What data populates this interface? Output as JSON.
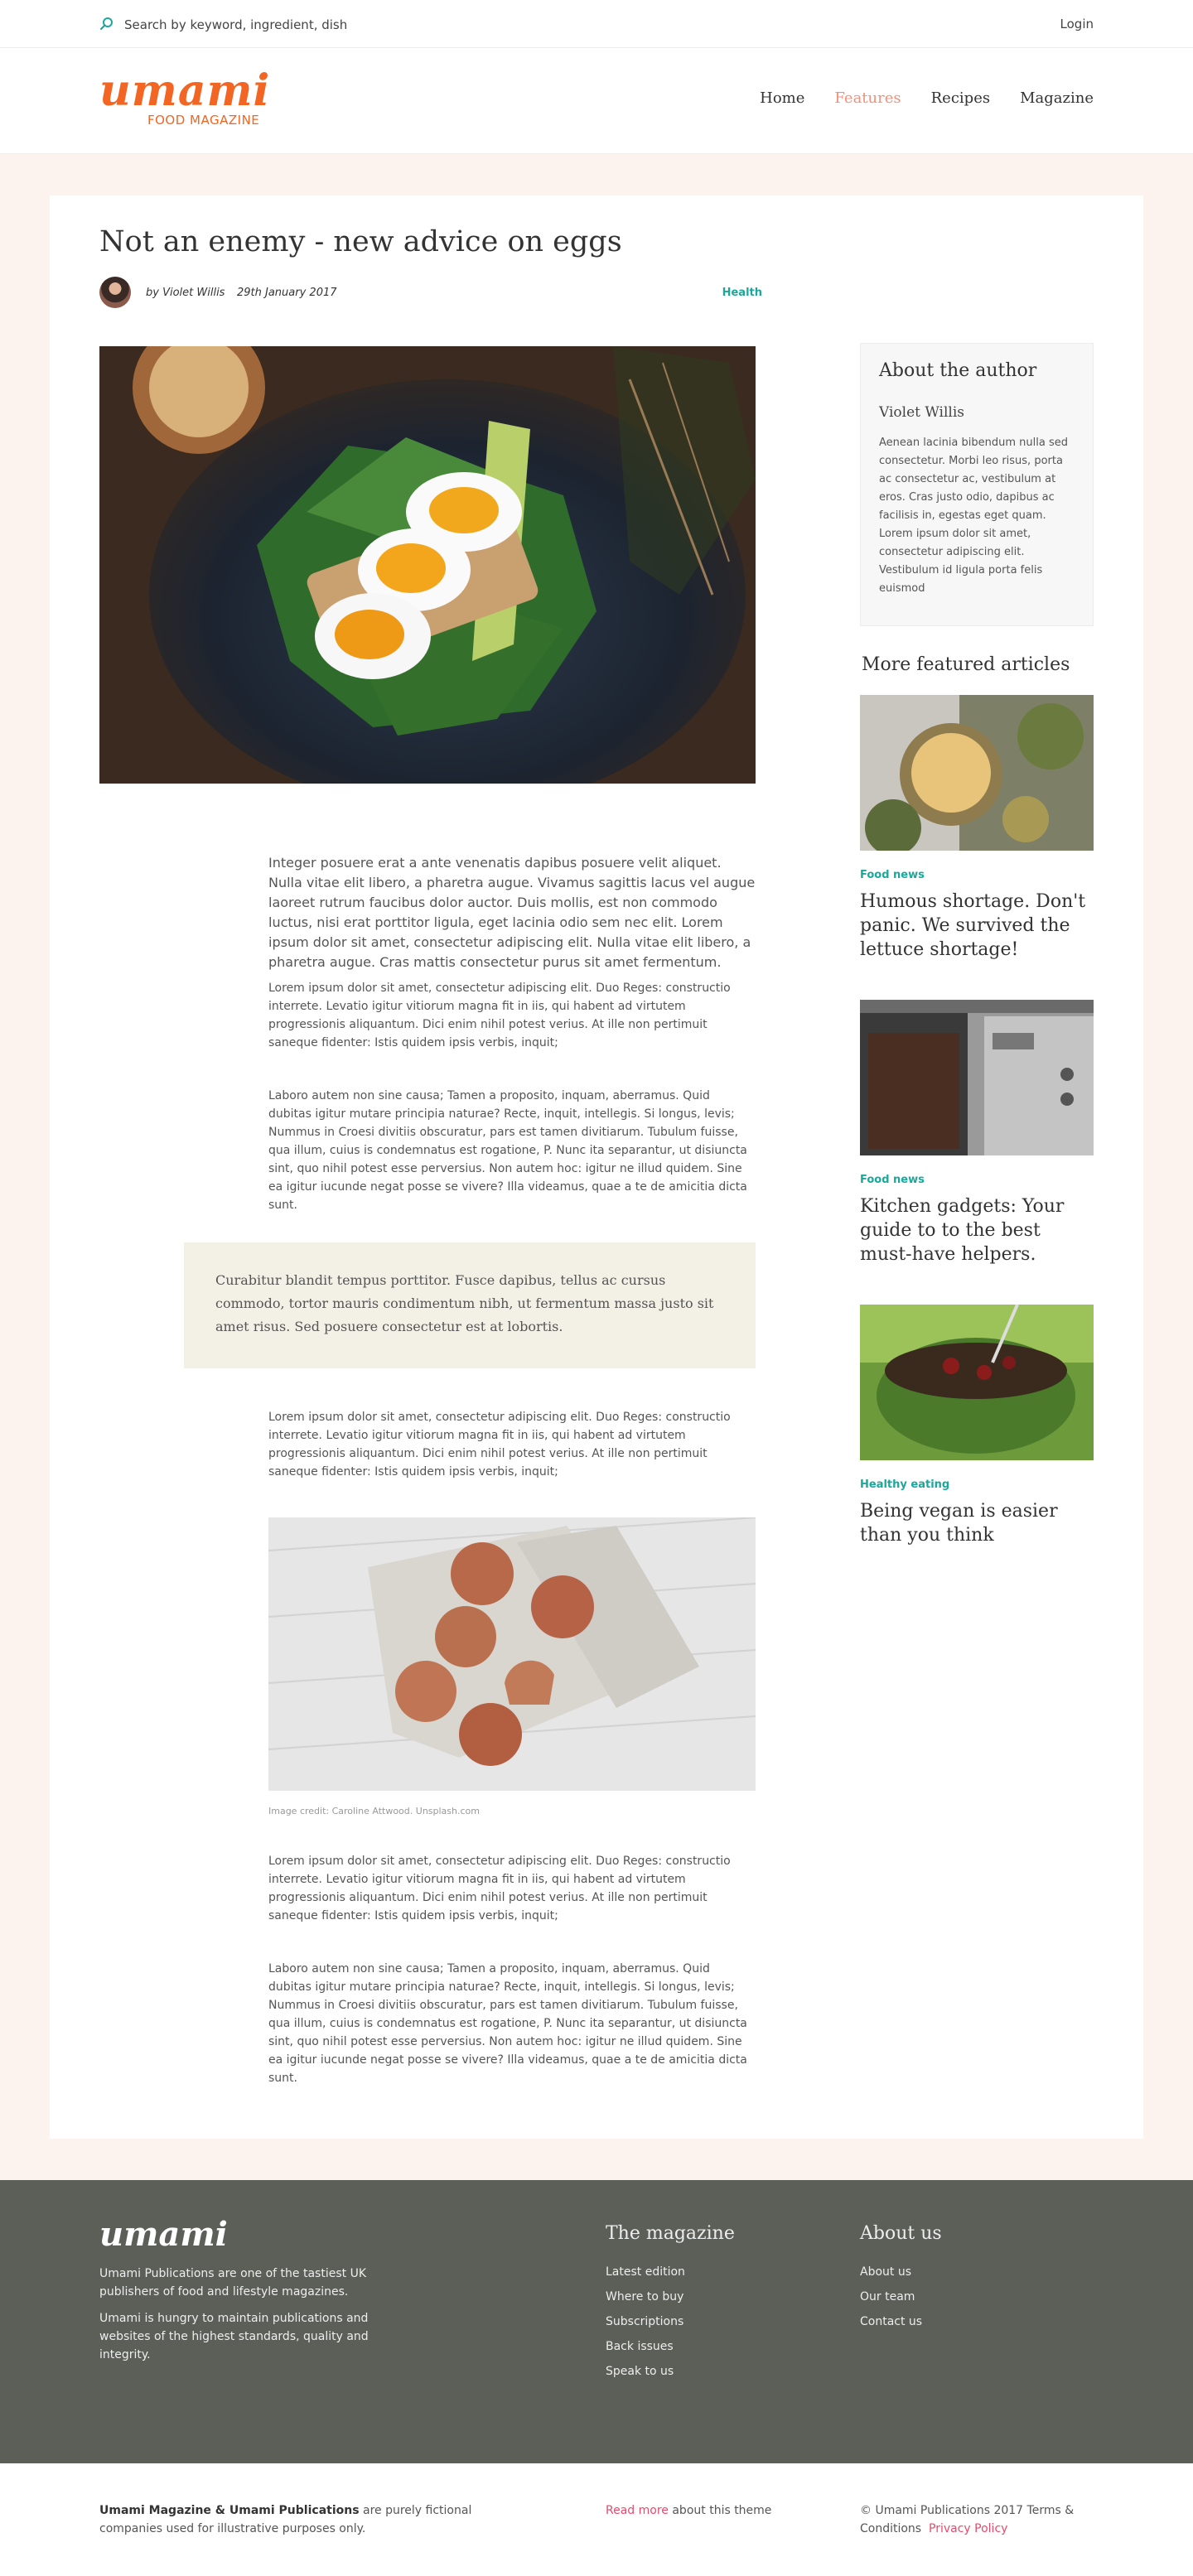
{
  "topbar": {
    "search_placeholder": "Search by keyword, ingredient, dish",
    "login": "Login"
  },
  "brand": {
    "logo_text": "umami",
    "logo_sub": "FOOD MAGAZINE",
    "accent": "#f26522",
    "teal": "#1aa89b",
    "pink": "#e84a6d"
  },
  "nav": {
    "items": [
      "Home",
      "Features",
      "Recipes",
      "Magazine"
    ],
    "active": "Features"
  },
  "article": {
    "title": "Not an enemy - new advice on eggs",
    "byline": "by Violet Willis",
    "date": "29th January 2017",
    "tag": "Health",
    "lead": "Integer posuere erat a ante venenatis dapibus posuere velit aliquet. Nulla vitae elit libero, a pharetra augue. Vivamus sagittis lacus vel augue laoreet rutrum faucibus dolor auctor. Duis mollis, est non commodo luctus, nisi erat porttitor ligula, eget lacinia odio sem nec elit. Lorem ipsum dolor sit amet, consectetur adipiscing elit. Nulla vitae elit libero, a pharetra augue. Cras mattis consectetur purus sit amet fermentum.",
    "p1": "Lorem ipsum dolor sit amet, consectetur adipiscing elit. Duo Reges: constructio interrete. Levatio igitur vitiorum magna fit in iis, qui habent ad virtutem progressionis aliquantum. Dici enim nihil potest verius. At ille non pertimuit saneque fidenter: Istis quidem ipsis verbis, inquit;",
    "p2": "Laboro autem non sine causa; Tamen a proposito, inquam, aberramus. Quid dubitas igitur mutare principia naturae? Recte, inquit, intellegis. Si longus, levis; Nummus in Croesi divitiis obscuratur, pars est tamen divitiarum. Tubulum fuisse, qua illum, cuius is condemnatus est rogatione, P. Nunc ita separantur, ut disiuncta sint, quo nihil potest esse perversius. Non autem hoc: igitur ne illud quidem. Sine ea igitur iucunde negat posse se vivere? Illa videamus, quae a te de amicitia dicta sunt.",
    "quote": "Curabitur blandit tempus porttitor. Fusce dapibus, tellus ac cursus commodo, tortor mauris condimentum nibh, ut fermentum massa justo sit amet risus. Sed posuere consectetur est at lobortis.",
    "p3": "Lorem ipsum dolor sit amet, consectetur adipiscing elit. Duo Reges: constructio interrete. Levatio igitur vitiorum magna fit in iis, qui habent ad virtutem progressionis aliquantum. Dici enim nihil potest verius. At ille non pertimuit saneque fidenter: Istis quidem ipsis verbis, inquit;",
    "credit": "Image credit: Caroline Attwood. Unsplash.com",
    "p4": "Lorem ipsum dolor sit amet, consectetur adipiscing elit. Duo Reges: constructio interrete. Levatio igitur vitiorum magna fit in iis, qui habent ad virtutem progressionis aliquantum. Dici enim nihil potest verius. At ille non pertimuit saneque fidenter: Istis quidem ipsis verbis, inquit;",
    "p5": "Laboro autem non sine causa; Tamen a proposito, inquam, aberramus. Quid dubitas igitur mutare principia naturae? Recte, inquit, intellegis. Si longus, levis; Nummus in Croesi divitiis obscuratur, pars est tamen divitiarum. Tubulum fuisse, qua illum, cuius is condemnatus est rogatione, P. Nunc ita separantur, ut disiuncta sint, quo nihil potest esse perversius. Non autem hoc: igitur ne illud quidem. Sine ea igitur iucunde negat posse se vivere? Illa videamus, quae a te de amicitia dicta sunt."
  },
  "sidebar": {
    "author_heading": "About the author",
    "author_name": "Violet Willis",
    "author_bio": "Aenean lacinia bibendum nulla sed consectetur. Morbi leo risus, porta ac consectetur ac, vestibulum at eros. Cras justo odio, dapibus ac facilisis in, egestas eget quam. Lorem ipsum dolor sit amet, consectetur adipiscing elit. Vestibulum id ligula porta felis euismod",
    "more_heading": "More featured articles",
    "articles": [
      {
        "category": "Food news",
        "title": "Humous shortage. Don't panic. We survived the lettuce shortage!"
      },
      {
        "category": "Food news",
        "title": "Kitchen gadgets: Your guide to to the best must-have helpers."
      },
      {
        "category": "Healthy eating",
        "title": "Being vegan is easier than you think"
      }
    ]
  },
  "footer": {
    "logo": "umami",
    "about1": "Umami Publications are one of the tastiest UK publishers of food and lifestyle magazines.",
    "about2": "Umami is hungry to maintain publications and websites of the highest standards, quality and integrity.",
    "magazine_heading": "The magazine",
    "magazine_links": [
      "Latest edition",
      "Where to buy",
      "Subscriptions",
      "Back issues",
      "Speak to us"
    ],
    "about_heading": "About us",
    "about_links": [
      "About us",
      "Our team",
      "Contact us"
    ],
    "fiction_strong": "Umami Magazine & Umami Publications",
    "fiction_rest": " are purely fictional companies used for illustrative purposes only.",
    "read_more": "Read more",
    "read_more_rest": " about this theme",
    "copyright": "© Umami Publications 2017 Terms & Conditions",
    "privacy": "Privacy Policy"
  }
}
